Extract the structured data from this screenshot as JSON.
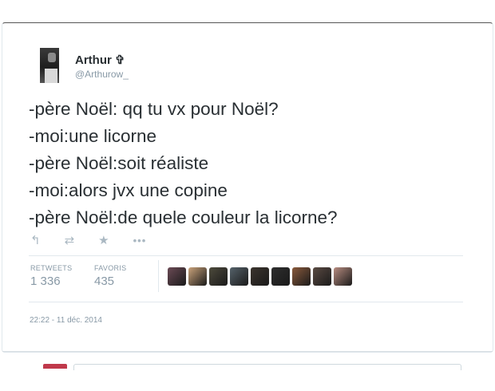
{
  "author": {
    "name": "Arthur ✞",
    "handle": "@Arthurow_",
    "avatar_icon": "profile-photo"
  },
  "tweet": {
    "lines": [
      "-père Noël: qq tu vx pour Noël?",
      "-moi:une licorne",
      "-père Noël:soit réaliste",
      "-moi:alors jvx une copine",
      "-père Noël:de quele couleur la licorne?"
    ]
  },
  "actions": {
    "reply_icon": "↰",
    "retweet_icon": "⇄",
    "favorite_icon": "★",
    "more_icon": "•••"
  },
  "stats": {
    "retweets_label": "RETWEETS",
    "retweets_value": "1 336",
    "favorites_label": "FAVORIS",
    "favorites_value": "435"
  },
  "favoriters": [
    {
      "color": "#6b4a55"
    },
    {
      "color": "#c9a27a"
    },
    {
      "color": "#4d4a3c"
    },
    {
      "color": "#55626a"
    },
    {
      "color": "#3b342e"
    },
    {
      "color": "#2e2e2e"
    },
    {
      "color": "#8a5a3c"
    },
    {
      "color": "#5a4a42"
    },
    {
      "color": "#b78c80"
    }
  ],
  "timestamp": "22:22 - 11 déc. 2014",
  "colors": {
    "text": "#292f33",
    "muted": "#8899a6",
    "icon": "#aab8c2",
    "border": "#e1e8ed"
  }
}
